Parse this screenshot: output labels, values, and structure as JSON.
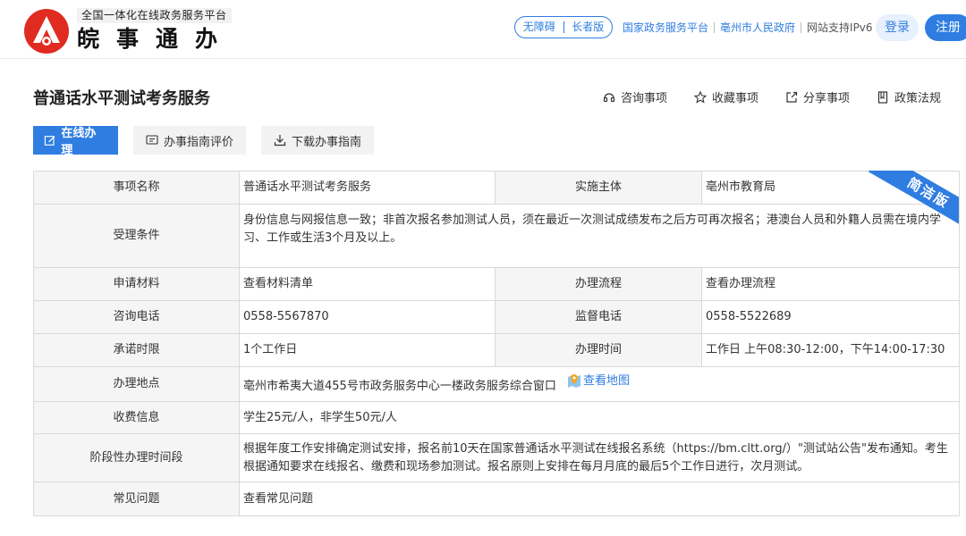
{
  "header": {
    "platform_tag": "全国一体化在线政务服务平台",
    "site_name": "皖事通办",
    "accessibility": "无障碍",
    "elder_mode": "长者版",
    "links": [
      "国家政务服务平台",
      "亳州市人民政府"
    ],
    "ipv6_note": "网站支持IPv6",
    "login": "登录",
    "register": "注册"
  },
  "page": {
    "title": "普通话水平测试考务服务",
    "actions": {
      "consult": "咨询事项",
      "favorite": "收藏事项",
      "share": "分享事项",
      "policy": "政策法规"
    },
    "buttons": {
      "online": "在线办理",
      "guide_eval": "办事指南评价",
      "download_guide": "下载办事指南"
    },
    "ribbon": "简洁版"
  },
  "table": {
    "item_name_label": "事项名称",
    "item_name": "普通话水平测试考务服务",
    "subject_label": "实施主体",
    "subject": "亳州市教育局",
    "conditions_label": "受理条件",
    "conditions": "身份信息与网报信息一致；非首次报名参加测试人员，须在最近一次测试成绩发布之后方可再次报名；港澳台人员和外籍人员需在境内学习、工作或生活3个月及以上。",
    "materials_label": "申请材料",
    "materials": "查看材料清单",
    "process_label": "办理流程",
    "process": "查看办理流程",
    "phone_label": "咨询电话",
    "phone": "0558-5567870",
    "supervise_label": "监督电话",
    "supervise": "0558-5522689",
    "limit_label": "承诺时限",
    "limit": "1个工作日",
    "hours_label": "办理时间",
    "hours": "工作日 上午08:30-12:00，下午14:00-17:30",
    "location_label": "办理地点",
    "location": "亳州市希夷大道455号市政务服务中心一楼政务服务综合窗口",
    "map_link": "查看地图",
    "fee_label": "收费信息",
    "fee": "学生25元/人，非学生50元/人",
    "stage_label": "阶段性办理时间段",
    "stage": "根据年度工作安排确定测试安排，报名前10天在国家普通话水平测试在线报名系统（https://bm.cltt.org/）\"测试站公告\"发布通知。考生根据通知要求在线报名、缴费和现场参加测试。报名原则上安排在每月月底的最后5个工作日进行，次月测试。",
    "faq_label": "常见问题",
    "faq": "查看常见问题"
  }
}
